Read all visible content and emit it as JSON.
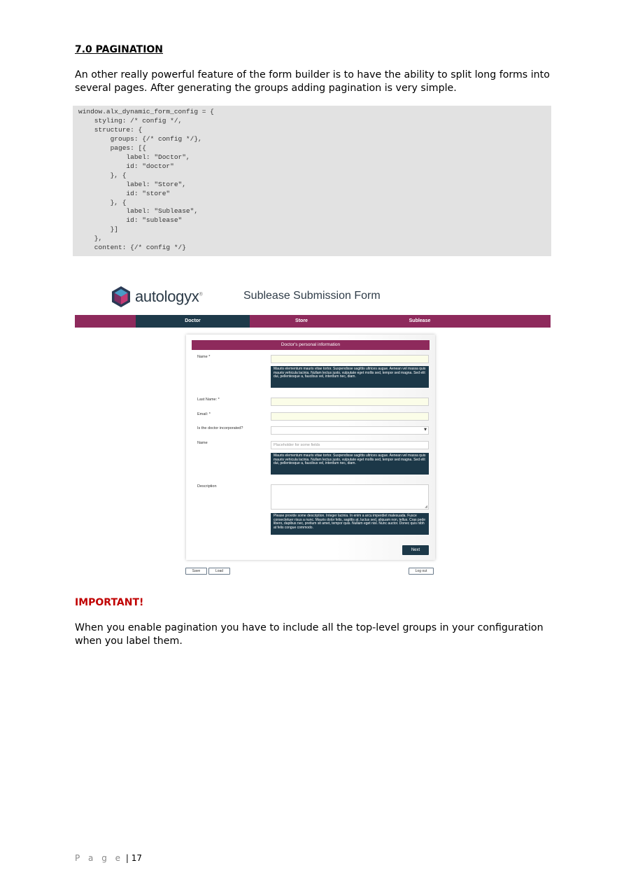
{
  "section": {
    "heading": "7.0 PAGINATION",
    "intro": "An other really powerful feature of the form builder is to have the ability to split long forms into several pages. After generating the groups adding pagination is very simple."
  },
  "code_block": "window.alx_dynamic_form_config = {\n    styling: /* config */,\n    structure: {\n        groups: {/* config */},\n        pages: [{\n            label: \"Doctor\",\n            id: \"doctor\"\n        }, {\n            label: \"Store\",\n            id: \"store\"\n        }, {\n            label: \"Sublease\",\n            id: \"sublease\"\n        }]\n    },\n    content: {/* config */}",
  "screenshot": {
    "brand": "autologyx",
    "brand_tm": "®",
    "form_title": "Sublease Submission Form",
    "tabs": [
      {
        "label": "Doctor"
      },
      {
        "label": "Store"
      },
      {
        "label": "Sublease"
      }
    ],
    "panel_title": "Doctor's personal information",
    "fields": {
      "name_label": "Name *",
      "last_name_label": "Last Name: *",
      "email_label": "Email: *",
      "incorporated_label": "Is the doctor incorporated?",
      "name2_label": "Name",
      "name2_placeholder": "Placeholder for some fields",
      "description_label": "Description"
    },
    "help_texts": {
      "name": "Mauris elementum mauris vitae tortor. Suspendisse sagittis ultrices augue. Aenean vel massa quis mauris vehicula lacinia. Nullam lectus justo, vulputate eget mollis sed, tempor sed magna. Sed elit dui, pellentesque a, faucibus vel, interdum nec, diam.",
      "name2": "Mauris elementum mauris vitae tortor. Suspendisse sagittis ultrices augue. Aenean vel massa quis mauris vehicula lacinia. Nullam lectus justo, vulputate eget mollis sed, tempor sed magna. Sed elit dui, pellentesque a, faucibus vel, interdum nec, diam.",
      "description": "Please provide some description. Integer lacinia. In enim a arcu imperdiet malesuada. Fusce consectetuer risus a nunc. Mauris dolor felis, sagittis at, luctus sed, aliquam non, tellus. Cras pede libero, dapibus nec, pretium sit amet, tempor quis. Nullam eget nisl. Nunc auctor. Donec quis nibh at felis congue commodo."
    },
    "buttons": {
      "next": "Next",
      "save": "Save",
      "load": "Load",
      "logout": "Log out"
    },
    "colors": {
      "brand_magenta": "#8e2a5c",
      "brand_navy": "#1c3848"
    }
  },
  "important": {
    "title": "IMPORTANT!",
    "text": "When you enable pagination you have to include all the top-level groups in your configuration when you label them."
  },
  "footer": {
    "page_word": "P a g e",
    "separator": "|",
    "page_number": "17"
  }
}
